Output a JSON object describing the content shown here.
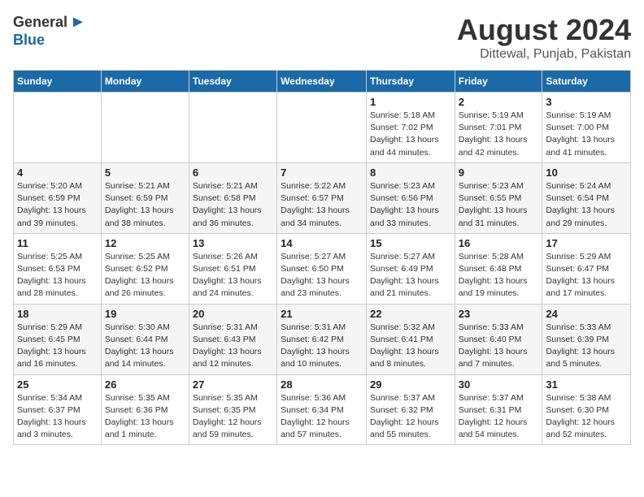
{
  "logo": {
    "general": "General",
    "blue": "Blue"
  },
  "title": "August 2024",
  "location": "Dittewal, Punjab, Pakistan",
  "days_header": [
    "Sunday",
    "Monday",
    "Tuesday",
    "Wednesday",
    "Thursday",
    "Friday",
    "Saturday"
  ],
  "weeks": [
    {
      "days": [
        {
          "num": "",
          "info": ""
        },
        {
          "num": "",
          "info": ""
        },
        {
          "num": "",
          "info": ""
        },
        {
          "num": "",
          "info": ""
        },
        {
          "num": "1",
          "info": "Sunrise: 5:18 AM\nSunset: 7:02 PM\nDaylight: 13 hours\nand 44 minutes."
        },
        {
          "num": "2",
          "info": "Sunrise: 5:19 AM\nSunset: 7:01 PM\nDaylight: 13 hours\nand 42 minutes."
        },
        {
          "num": "3",
          "info": "Sunrise: 5:19 AM\nSunset: 7:00 PM\nDaylight: 13 hours\nand 41 minutes."
        }
      ]
    },
    {
      "days": [
        {
          "num": "4",
          "info": "Sunrise: 5:20 AM\nSunset: 6:59 PM\nDaylight: 13 hours\nand 39 minutes."
        },
        {
          "num": "5",
          "info": "Sunrise: 5:21 AM\nSunset: 6:59 PM\nDaylight: 13 hours\nand 38 minutes."
        },
        {
          "num": "6",
          "info": "Sunrise: 5:21 AM\nSunset: 6:58 PM\nDaylight: 13 hours\nand 36 minutes."
        },
        {
          "num": "7",
          "info": "Sunrise: 5:22 AM\nSunset: 6:57 PM\nDaylight: 13 hours\nand 34 minutes."
        },
        {
          "num": "8",
          "info": "Sunrise: 5:23 AM\nSunset: 6:56 PM\nDaylight: 13 hours\nand 33 minutes."
        },
        {
          "num": "9",
          "info": "Sunrise: 5:23 AM\nSunset: 6:55 PM\nDaylight: 13 hours\nand 31 minutes."
        },
        {
          "num": "10",
          "info": "Sunrise: 5:24 AM\nSunset: 6:54 PM\nDaylight: 13 hours\nand 29 minutes."
        }
      ]
    },
    {
      "days": [
        {
          "num": "11",
          "info": "Sunrise: 5:25 AM\nSunset: 6:53 PM\nDaylight: 13 hours\nand 28 minutes."
        },
        {
          "num": "12",
          "info": "Sunrise: 5:25 AM\nSunset: 6:52 PM\nDaylight: 13 hours\nand 26 minutes."
        },
        {
          "num": "13",
          "info": "Sunrise: 5:26 AM\nSunset: 6:51 PM\nDaylight: 13 hours\nand 24 minutes."
        },
        {
          "num": "14",
          "info": "Sunrise: 5:27 AM\nSunset: 6:50 PM\nDaylight: 13 hours\nand 23 minutes."
        },
        {
          "num": "15",
          "info": "Sunrise: 5:27 AM\nSunset: 6:49 PM\nDaylight: 13 hours\nand 21 minutes."
        },
        {
          "num": "16",
          "info": "Sunrise: 5:28 AM\nSunset: 6:48 PM\nDaylight: 13 hours\nand 19 minutes."
        },
        {
          "num": "17",
          "info": "Sunrise: 5:29 AM\nSunset: 6:47 PM\nDaylight: 13 hours\nand 17 minutes."
        }
      ]
    },
    {
      "days": [
        {
          "num": "18",
          "info": "Sunrise: 5:29 AM\nSunset: 6:45 PM\nDaylight: 13 hours\nand 16 minutes."
        },
        {
          "num": "19",
          "info": "Sunrise: 5:30 AM\nSunset: 6:44 PM\nDaylight: 13 hours\nand 14 minutes."
        },
        {
          "num": "20",
          "info": "Sunrise: 5:31 AM\nSunset: 6:43 PM\nDaylight: 13 hours\nand 12 minutes."
        },
        {
          "num": "21",
          "info": "Sunrise: 5:31 AM\nSunset: 6:42 PM\nDaylight: 13 hours\nand 10 minutes."
        },
        {
          "num": "22",
          "info": "Sunrise: 5:32 AM\nSunset: 6:41 PM\nDaylight: 13 hours\nand 8 minutes."
        },
        {
          "num": "23",
          "info": "Sunrise: 5:33 AM\nSunset: 6:40 PM\nDaylight: 13 hours\nand 7 minutes."
        },
        {
          "num": "24",
          "info": "Sunrise: 5:33 AM\nSunset: 6:39 PM\nDaylight: 13 hours\nand 5 minutes."
        }
      ]
    },
    {
      "days": [
        {
          "num": "25",
          "info": "Sunrise: 5:34 AM\nSunset: 6:37 PM\nDaylight: 13 hours\nand 3 minutes."
        },
        {
          "num": "26",
          "info": "Sunrise: 5:35 AM\nSunset: 6:36 PM\nDaylight: 13 hours\nand 1 minute."
        },
        {
          "num": "27",
          "info": "Sunrise: 5:35 AM\nSunset: 6:35 PM\nDaylight: 12 hours\nand 59 minutes."
        },
        {
          "num": "28",
          "info": "Sunrise: 5:36 AM\nSunset: 6:34 PM\nDaylight: 12 hours\nand 57 minutes."
        },
        {
          "num": "29",
          "info": "Sunrise: 5:37 AM\nSunset: 6:32 PM\nDaylight: 12 hours\nand 55 minutes."
        },
        {
          "num": "30",
          "info": "Sunrise: 5:37 AM\nSunset: 6:31 PM\nDaylight: 12 hours\nand 54 minutes."
        },
        {
          "num": "31",
          "info": "Sunrise: 5:38 AM\nSunset: 6:30 PM\nDaylight: 12 hours\nand 52 minutes."
        }
      ]
    }
  ]
}
